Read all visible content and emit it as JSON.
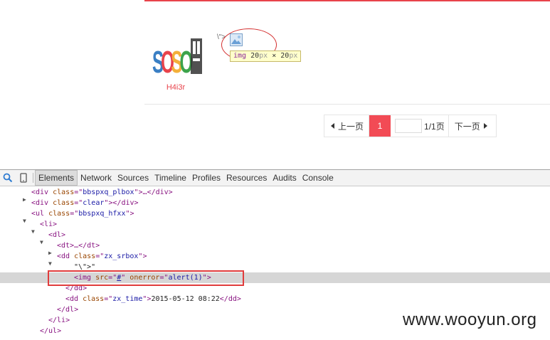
{
  "page": {
    "user_name": "H4i3r",
    "content_text": "\\\">",
    "tooltip": {
      "tag": "img",
      "w": "20",
      "unit": "px",
      "x": "×",
      "h": "20"
    }
  },
  "pagination": {
    "prev_label": "上一页",
    "current": "1",
    "input_value": "",
    "total": "1/1页",
    "next_label": "下一页"
  },
  "devtools": {
    "tabs": [
      "Elements",
      "Network",
      "Sources",
      "Timeline",
      "Profiles",
      "Resources",
      "Audits",
      "Console"
    ],
    "tree": [
      {
        "indent": 44,
        "tri": "▶",
        "html": "div_plbox"
      },
      {
        "indent": 44,
        "tri": "",
        "html": "div_clear"
      },
      {
        "indent": 44,
        "tri": "▼",
        "html": "ul"
      },
      {
        "indent": 56,
        "tri": "▼",
        "html": "li"
      },
      {
        "indent": 68,
        "tri": "▼",
        "html": "dl"
      },
      {
        "indent": 80,
        "tri": "▶",
        "html": "dt"
      },
      {
        "indent": 80,
        "tri": "▼",
        "html": "dd_srbox"
      },
      {
        "indent": 104,
        "tri": "",
        "html": "text"
      },
      {
        "indent": 104,
        "tri": "",
        "html": "img"
      },
      {
        "indent": 92,
        "tri": "",
        "html": "dd_close"
      },
      {
        "indent": 92,
        "tri": "",
        "html": "dd_time"
      },
      {
        "indent": 80,
        "tri": "",
        "html": "dl_close"
      },
      {
        "indent": 68,
        "tri": "",
        "html": "li_close"
      },
      {
        "indent": 56,
        "tri": "",
        "html": "ul_close"
      }
    ],
    "strings": {
      "div_plbox": [
        "<div ",
        "class",
        "=\"",
        "bbspxq_plbox",
        "\">…</div>"
      ],
      "div_clear": [
        "<div ",
        "class",
        "=\"",
        "clear",
        "\"></div>"
      ],
      "ul": [
        "<ul ",
        "class",
        "=\"",
        "bbspxq_hfxx",
        "\">"
      ],
      "li": "<li>",
      "dl": "<dl>",
      "dt": "<dt>…</dt>",
      "dd_srbox": [
        "<dd ",
        "class",
        "=\"",
        "zx_srbox",
        "\">"
      ],
      "text": "\"\\\">\"",
      "img": [
        "<img ",
        "src",
        "=\"",
        "#",
        "\" ",
        "onerror",
        "=\"",
        "alert(1)",
        "\">"
      ],
      "dd_close": "</dd>",
      "dd_time": [
        "<dd ",
        "class",
        "=\"",
        "zx_time",
        "\">",
        "2015-05-12 08:22",
        "</dd>"
      ],
      "dl_close": "</dl>",
      "li_close": "</li>",
      "ul_close": "</ul>"
    }
  },
  "watermark": "www.wooyun.org",
  "colors": {
    "accent_red": "#f24b55",
    "selection": "#d6d6d6",
    "tooltip_bg": "#ffffcc"
  }
}
